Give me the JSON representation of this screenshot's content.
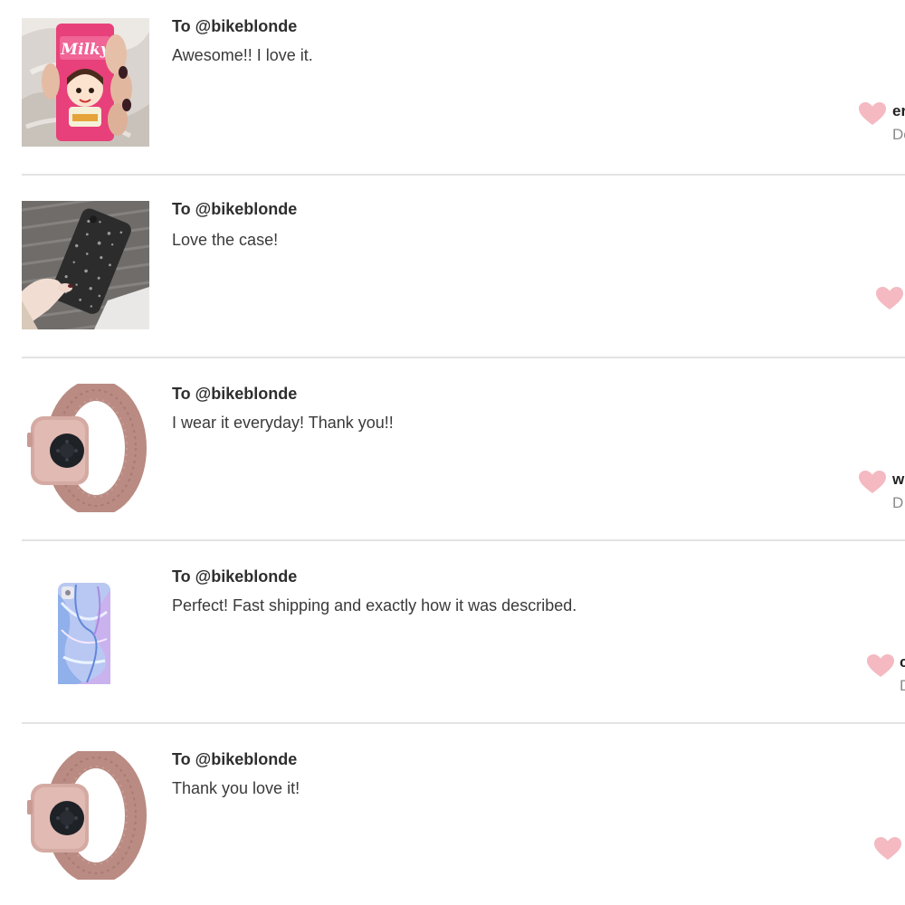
{
  "colors": {
    "heart": "#f4b9c1",
    "divider": "#e3e3e3",
    "recipient_text": "#2e2e2e"
  },
  "reviews": [
    {
      "recipient": "To @bikeblonde",
      "comment": "Awesome!! I love it.",
      "author_fragment": "er",
      "date_fragment": "De",
      "image": "milky-phone-case",
      "icon": "heart-icon"
    },
    {
      "recipient": "To @bikeblonde",
      "comment": "Love the case!",
      "image": "glitter-phone-case",
      "icon": "heart-icon"
    },
    {
      "recipient": "To @bikeblonde",
      "comment": "I wear it everyday! Thank you!!",
      "author_fragment": "w",
      "date_fragment": "D",
      "image": "rose-gold-watch-band",
      "icon": "heart-icon"
    },
    {
      "recipient": "To @bikeblonde",
      "comment": "Perfect! Fast shipping and exactly how it was described.",
      "author_fragment": "c",
      "date_fragment": "D",
      "image": "marble-phone-case",
      "icon": "heart-icon"
    },
    {
      "recipient": "To @bikeblonde",
      "comment": "Thank you love it!",
      "image": "rose-gold-watch-band",
      "icon": "heart-icon"
    }
  ]
}
